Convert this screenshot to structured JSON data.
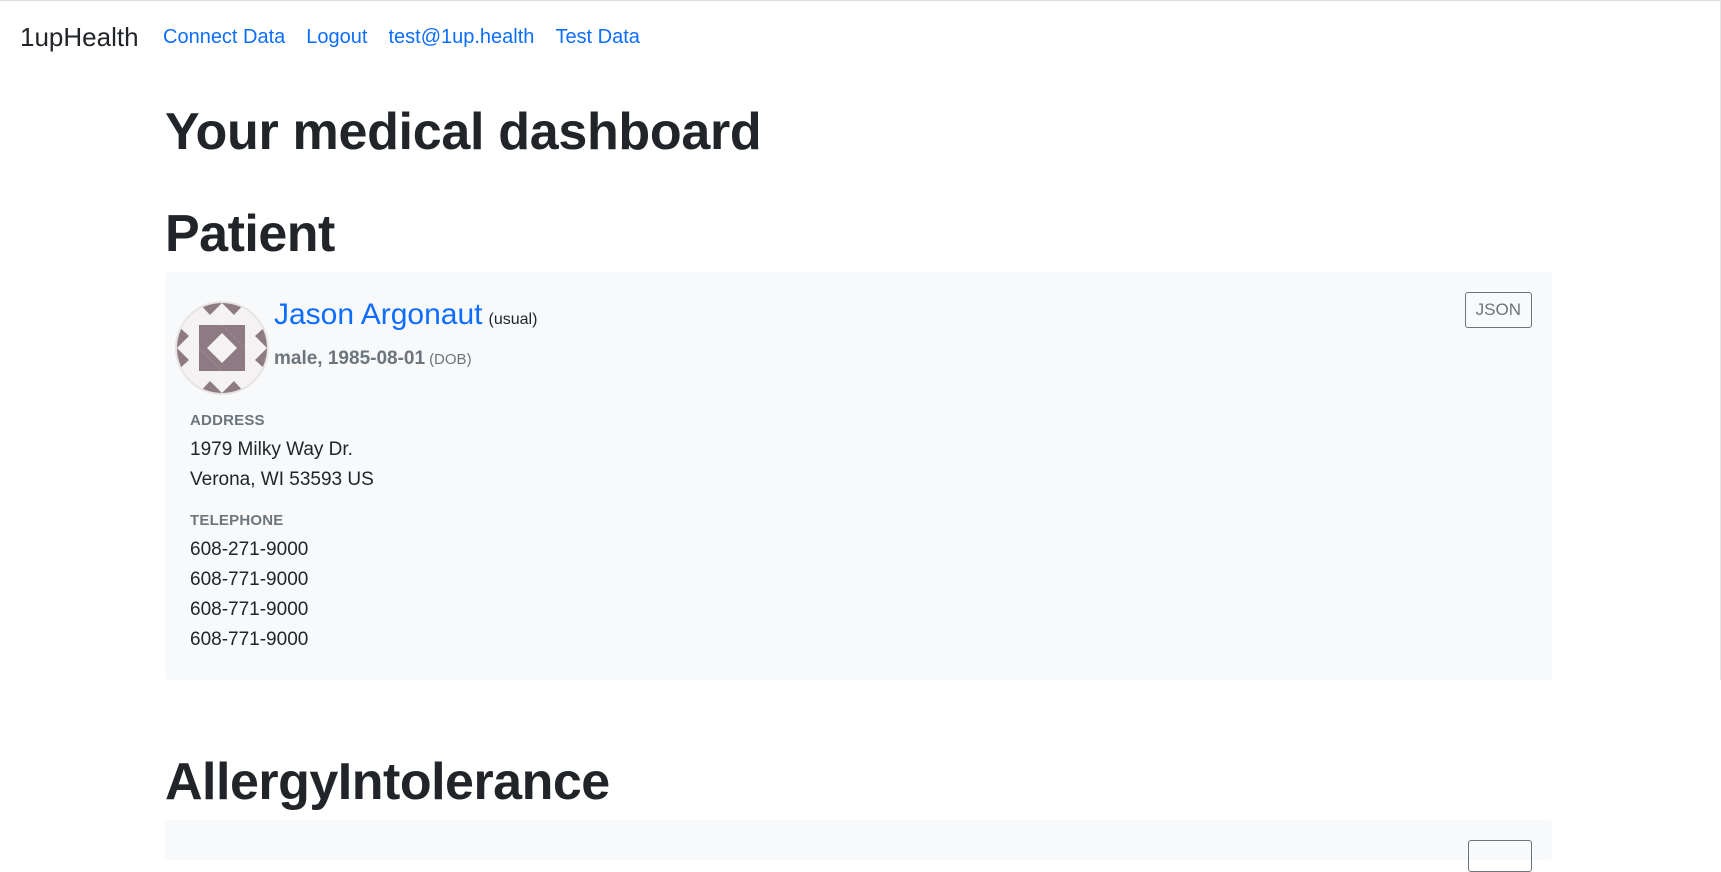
{
  "nav": {
    "brand": "1upHealth",
    "links": [
      "Connect Data",
      "Logout",
      "test@1up.health",
      "Test Data"
    ]
  },
  "page_title": "Your medical dashboard",
  "patient_section": {
    "title": "Patient",
    "name": "Jason Argonaut",
    "name_use": "(usual)",
    "demographics": "male, 1985-08-01",
    "dob_label": "(DOB)",
    "json_button": "JSON",
    "address_label": "ADDRESS",
    "address_lines": [
      "1979 Milky Way Dr.",
      "Verona, WI 53593 US"
    ],
    "telephone_label": "TELEPHONE",
    "telephones": [
      "608-271-9000",
      "608-771-9000",
      "608-771-9000",
      "608-771-9000"
    ]
  },
  "allergy_section": {
    "title": "AllergyIntolerance"
  },
  "colors": {
    "link": "#0d6efd",
    "card_bg": "#f8f9fa",
    "muted": "#6c757d",
    "avatar": "#8e7a82"
  }
}
